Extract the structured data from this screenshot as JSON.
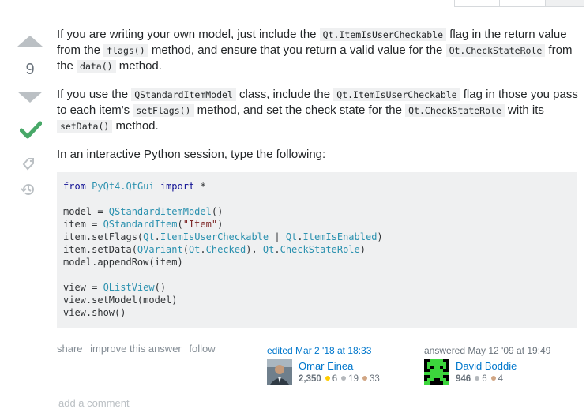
{
  "vote": {
    "count": "9"
  },
  "paragraphs": {
    "p1": {
      "t1": "If you are writing your own model, just include the ",
      "c1": "Qt.ItemIsUserCheckable",
      "t2": " flag in the return value from the ",
      "c2": "flags()",
      "t3": " method, and ensure that you return a valid value for the ",
      "c3": "Qt.CheckStateRole",
      "t4": " from the ",
      "c4": "data()",
      "t5": " method."
    },
    "p2": {
      "t1": "If you use the ",
      "c1": "QStandardItemModel",
      "t2": " class, include the ",
      "c2": "Qt.ItemIsUserCheckable",
      "t3": " flag in those you pass to each item's ",
      "c3": "setFlags()",
      "t4": " method, and set the check state for the ",
      "c4": "Qt.CheckStateRole",
      "t5": " with its ",
      "c5": "setData()",
      "t6": " method."
    },
    "p3": "In an interactive Python session, type the following:"
  },
  "code": {
    "l1a": "from",
    "l1b": " ",
    "l1c": "PyQt4.QtGui",
    "l1d": " ",
    "l1e": "import",
    "l1f": " *",
    "l2a": "model = ",
    "l2b": "QStandardItemModel",
    "l2c": "()",
    "l3a": "item = ",
    "l3b": "QStandardItem",
    "l3c": "(",
    "l3d": "\"Item\"",
    "l3e": ")",
    "l4a": "item.setFlags(",
    "l4b": "Qt",
    "l4c": ".",
    "l4d": "ItemIsUserCheckable",
    "l4e": " | ",
    "l4f": "Qt",
    "l4g": ".",
    "l4h": "ItemIsEnabled",
    "l4i": ")",
    "l5a": "item.setData(",
    "l5b": "QVariant",
    "l5c": "(",
    "l5d": "Qt",
    "l5e": ".",
    "l5f": "Checked",
    "l5g": "), ",
    "l5h": "Qt",
    "l5i": ".",
    "l5j": "CheckStateRole",
    "l5k": ")",
    "l6": "model.appendRow(item)",
    "l7a": "view = ",
    "l7b": "QListView",
    "l7c": "()",
    "l8": "view.setModel(model)",
    "l9": "view.show()"
  },
  "menu": {
    "share": "share",
    "improve": "improve this answer",
    "follow": "follow"
  },
  "editor": {
    "action": "edited Mar 2 '18 at 18:33",
    "name": "Omar Einea",
    "rep": "2,350",
    "gold": "6",
    "silver": "19",
    "bronze": "33"
  },
  "owner": {
    "action": "answered May 12 '09 at 19:49",
    "name": "David Boddie",
    "rep": "946",
    "silver": "6",
    "bronze": "4"
  },
  "comments": {
    "add": "add a comment"
  },
  "icons": {
    "up": "arrow-up-icon",
    "down": "arrow-down-icon",
    "accepted": "check-icon",
    "bounty": "bounty-icon",
    "history": "history-icon"
  },
  "colors": {
    "accepted": "#48a868",
    "link": "#0077cc",
    "muted": "#848d95"
  }
}
